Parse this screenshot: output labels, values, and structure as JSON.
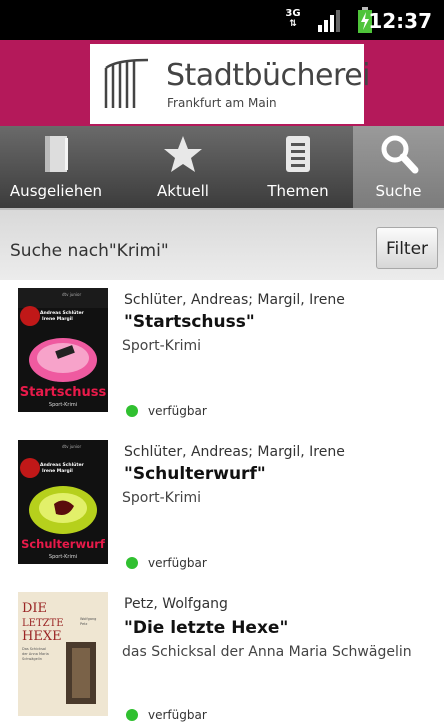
{
  "status_bar": {
    "network": "3G",
    "time": "12:37"
  },
  "header": {
    "title": "Stadtbücherei",
    "subtitle": "Frankfurt am Main"
  },
  "tabs": [
    {
      "label": "Ausgeliehen",
      "icon": "book-icon"
    },
    {
      "label": "Aktuell",
      "icon": "star-icon"
    },
    {
      "label": "Themen",
      "icon": "list-icon"
    },
    {
      "label": "Suche",
      "icon": "search-icon",
      "active": true
    }
  ],
  "search": {
    "query_text": "Suche nach\"Krimi\"",
    "filter_label": "Filter"
  },
  "results": [
    {
      "author": "Schlüter, Andreas; Margil, Irene",
      "title": "\"Startschuss\"",
      "subtitle": "Sport-Krimi",
      "availability": "verfügbar",
      "cover": {
        "title": "Startschuss",
        "series": "Sport-Krimi",
        "authors": "Andreas Schlüter Irene Margil",
        "publisher": "dtv junior"
      }
    },
    {
      "author": "Schlüter, Andreas; Margil, Irene",
      "title": "\"Schulterwurf\"",
      "subtitle": "Sport-Krimi",
      "availability": "verfügbar",
      "cover": {
        "title": "Schulterwurf",
        "series": "Sport-Krimi",
        "authors": "Andreas Schlüter Irene Margil",
        "publisher": "dtv junior"
      }
    },
    {
      "author": "Petz, Wolfgang",
      "title": "\"Die letzte Hexe\"",
      "subtitle": "das Schicksal der Anna Maria Schwägelin",
      "availability": "verfügbar",
      "cover": {
        "title": "DIE LETZTE HEXE",
        "authors": "Wolfgang Petz",
        "series": "Das Schicksal der Anna Maria Schwägelin"
      }
    }
  ],
  "colors": {
    "brand": "#b4195a",
    "available": "#30c030"
  }
}
